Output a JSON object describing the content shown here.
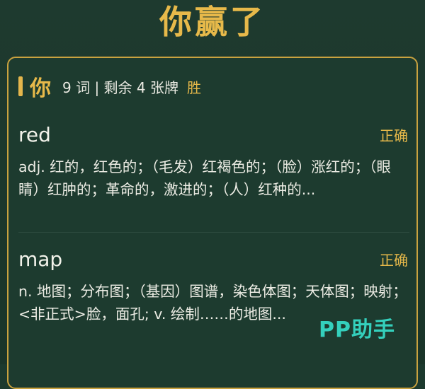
{
  "header": {
    "title": "你赢了"
  },
  "player": {
    "name": "你",
    "stats": "9 词 | 剩余 4 张牌",
    "result": "胜"
  },
  "words": [
    {
      "word": "red",
      "verdict": "正确",
      "definition": "adj. 红的，红色的；（毛发）红褐色的；（脸）涨红的；（眼睛）红肿的；革命的，激进的；（人）红种的..."
    },
    {
      "word": "map",
      "verdict": "正确",
      "definition": "n. 地图；分布图；（基因）图谱，染色体图；天体图；映射；<非正式>脸，面孔; v. 绘制……的地图..."
    }
  ],
  "watermark": "PP助手",
  "colors": {
    "background": "#1e3a2f",
    "accent": "#e7b94a",
    "text": "#ecece4",
    "watermark": "#36d8c4"
  }
}
